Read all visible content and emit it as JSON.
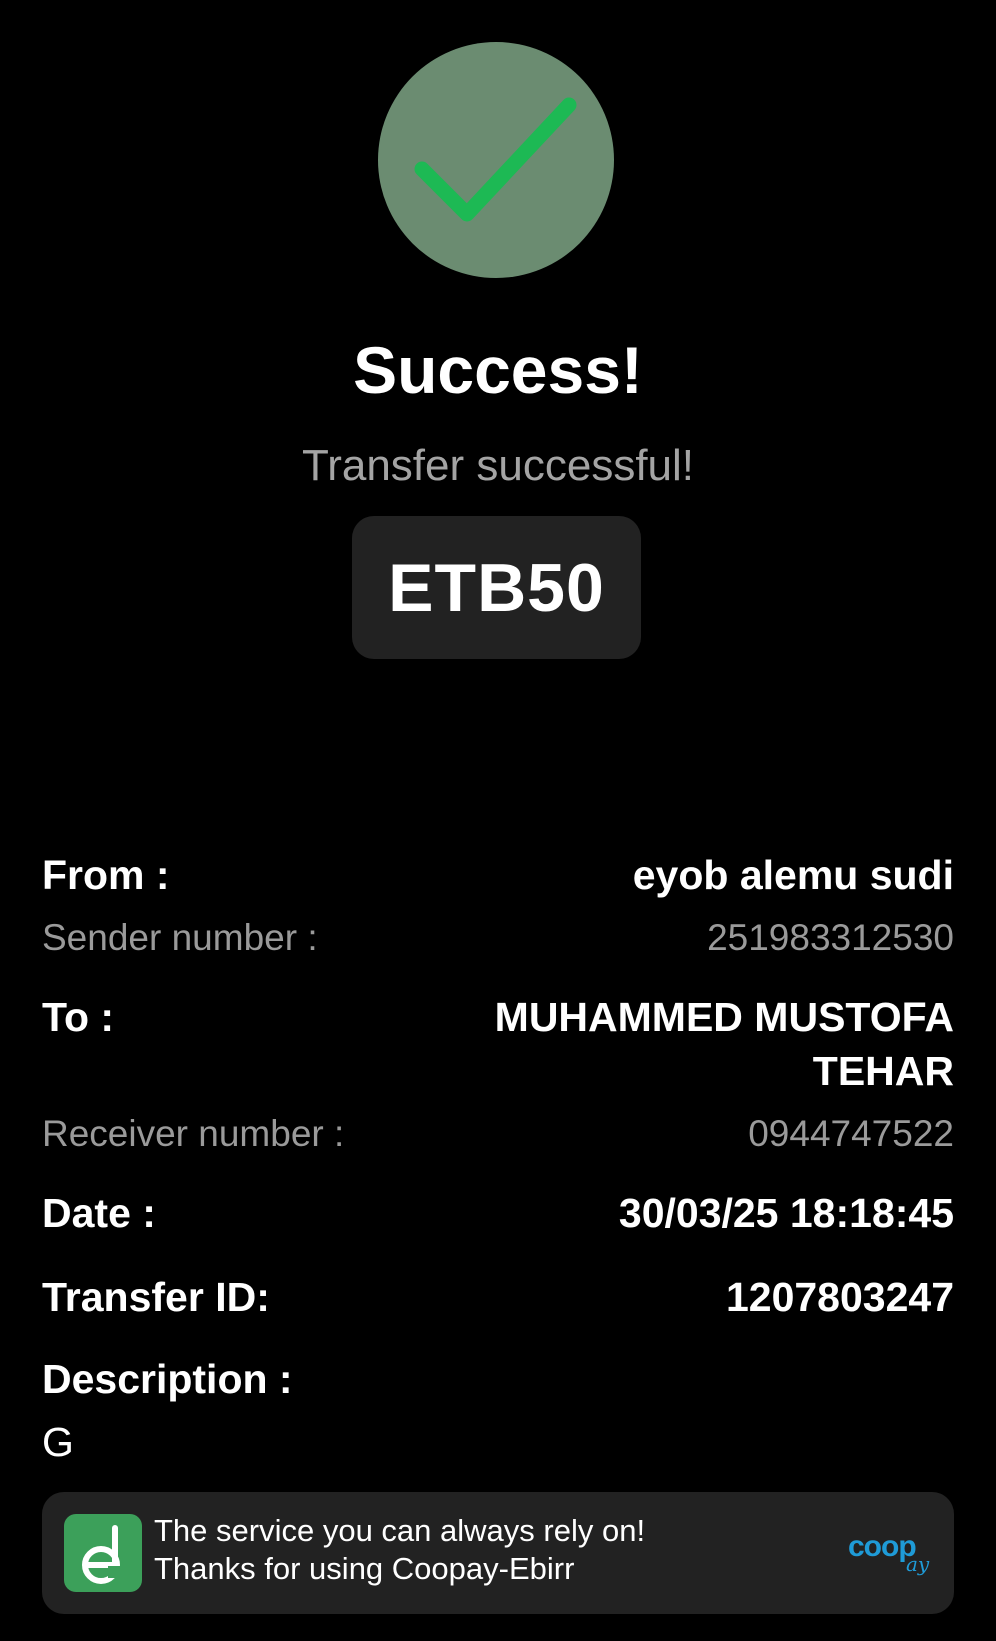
{
  "status": {
    "icon": "check-circle-icon",
    "title": "Success!",
    "subtitle": "Transfer successful!",
    "amount": "ETB50"
  },
  "details": {
    "from_label": "From :",
    "from_value": "eyob alemu sudi",
    "sender_label": "Sender number :",
    "sender_value": "251983312530",
    "to_label": "To :",
    "to_value": "MUHAMMED MUSTOFA TEHAR",
    "receiver_label": "Receiver number :",
    "receiver_value": "0944747522",
    "date_label": "Date :",
    "date_value": "30/03/25 18:18:45",
    "transfer_id_label": "Transfer ID:",
    "transfer_id_value": "1207803247",
    "description_label": "Description :",
    "description_value": "G"
  },
  "footer": {
    "line1": "The service you can always rely on!",
    "line2": "Thanks for using Coopay-Ebirr",
    "app_icon": "ebirr-logo-icon",
    "brand_main": "coop",
    "brand_sub": "ay"
  },
  "colors": {
    "badge_bg": "#6b8c71",
    "check": "#1db954",
    "card_bg": "#222222",
    "muted_text": "#9a9a9a",
    "brand_blue": "#1f9bd7",
    "logo_green": "#3ca05a"
  }
}
